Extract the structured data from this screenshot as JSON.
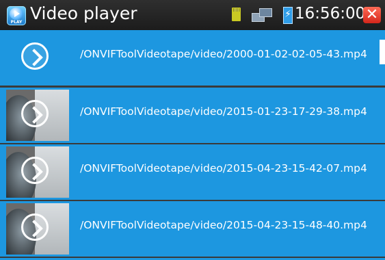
{
  "titlebar": {
    "title": "Video player",
    "icon_label": "PLAY",
    "clock": "16:56:00",
    "icons": [
      "play-app-icon",
      "sd-card-icon",
      "network-icon",
      "battery-charging-icon",
      "close-icon"
    ],
    "close_glyph": "✕"
  },
  "colors": {
    "row_bg": "#1d97e0",
    "titlebar_bg": "#262626",
    "close_bg": "#e0331f"
  },
  "files": [
    {
      "name": "/ONVIFToolVideotape/video/2000-01-02-02-05-43.mp4",
      "thumbnail": false
    },
    {
      "name": "/ONVIFToolVideotape/video/2015-01-23-17-29-38.mp4",
      "thumbnail": true
    },
    {
      "name": "/ONVIFToolVideotape/video/2015-04-23-15-42-07.mp4",
      "thumbnail": true
    },
    {
      "name": "/ONVIFToolVideotape/video/2015-04-23-15-48-40.mp4",
      "thumbnail": true
    }
  ]
}
